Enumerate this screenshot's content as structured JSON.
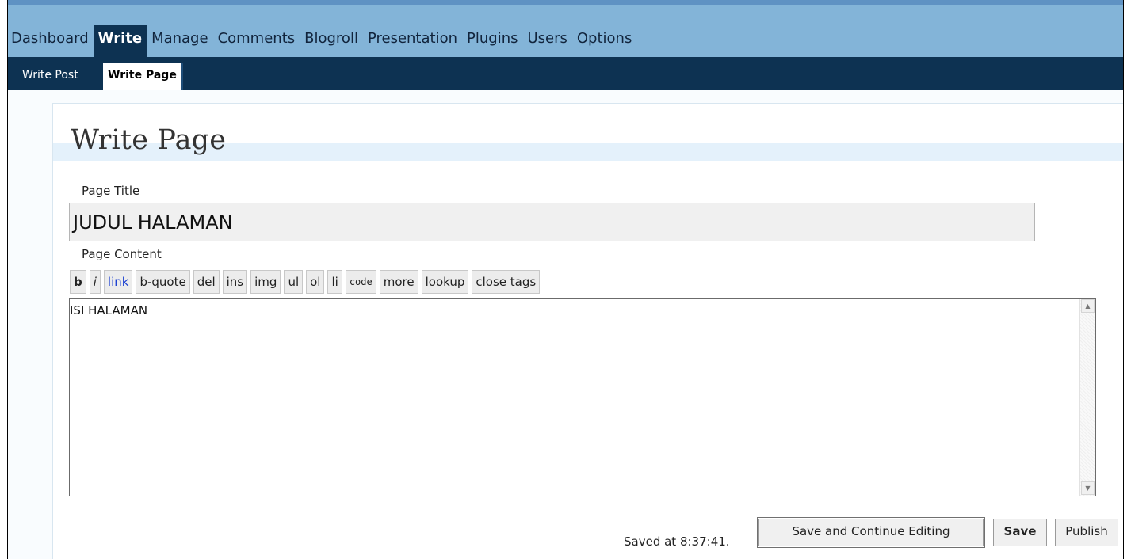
{
  "nav": {
    "main": [
      "Dashboard",
      "Write",
      "Manage",
      "Comments",
      "Blogroll",
      "Presentation",
      "Plugins",
      "Users",
      "Options"
    ],
    "active_main": "Write",
    "sub": [
      "Write Post",
      "Write Page"
    ],
    "active_sub": "Write Page"
  },
  "page": {
    "heading": "Write Page",
    "title_label": "Page Title",
    "title_value": "JUDUL HALAMAN",
    "content_label": "Page Content",
    "content_value": "ISI HALAMAN"
  },
  "toolbar": [
    "b",
    "i",
    "link",
    "b-quote",
    "del",
    "ins",
    "img",
    "ul",
    "ol",
    "li",
    "code",
    "more",
    "lookup",
    "close tags"
  ],
  "footer": {
    "saved_text": "Saved at 8:37:41.",
    "save_continue_label": "Save and Continue Editing",
    "save_label": "Save",
    "publish_label": "Publish"
  },
  "scrollbar": {
    "up_icon": "arrow-up-icon",
    "down_icon": "arrow-down-icon"
  }
}
